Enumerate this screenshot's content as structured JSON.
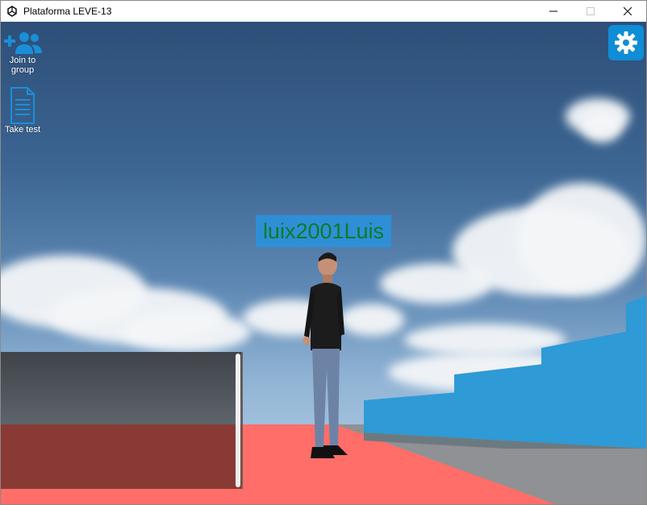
{
  "window": {
    "title": "Plataforma LEVE-13",
    "controls": [
      "minimize",
      "maximize",
      "close"
    ]
  },
  "hud": {
    "join_group": {
      "label": "Join to group",
      "icon": "add-group-icon"
    },
    "take_test": {
      "label": "Take test",
      "icon": "document-icon"
    },
    "settings": {
      "icon": "gear-icon"
    }
  },
  "player": {
    "name": "luix2001Luis"
  },
  "colors": {
    "accent": "#0f8dd6",
    "name_text": "#0f7a2a",
    "floor": "#ff6e69",
    "stairs": "#2e9ad6"
  }
}
